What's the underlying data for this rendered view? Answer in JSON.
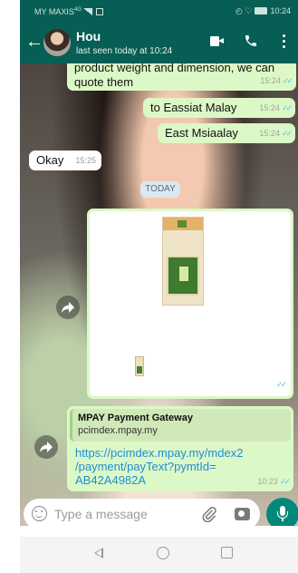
{
  "status_bar": {
    "carrier": "MY MAXIS",
    "network": "4G",
    "time": "10:24"
  },
  "header": {
    "back_icon": "arrow-left-icon",
    "contact_name": "Hou",
    "last_seen": "last seen today at 10:24",
    "video_icon": "video-camera-icon",
    "call_icon": "phone-icon",
    "menu_icon": "more-vert-icon",
    "bar_color": "#075e54"
  },
  "messages": [
    {
      "direction": "out",
      "text": "product weight and dimension, we can quote them",
      "time": "15:24",
      "read": true
    },
    {
      "direction": "out",
      "text": "to Eassiat Malay",
      "time": "15:24",
      "read": true
    },
    {
      "direction": "out",
      "text": "East Msiaalay",
      "time": "15:24",
      "read": true
    },
    {
      "direction": "in",
      "text": "Okay",
      "time": "15:25"
    }
  ],
  "date_divider": "TODAY",
  "image_message": {
    "direction": "out",
    "time": "10:23",
    "read": true
  },
  "link_message": {
    "direction": "out",
    "preview_title": "MPAY Payment Gateway",
    "preview_domain": "pcimdex.mpay.my",
    "url": "https://pcimdex.mpay.my/mdex2/payment/payText?pymtId=AB42A4982A",
    "time": "10:23",
    "read": true
  },
  "colors": {
    "outgoing_bubble": "#dcf8c6",
    "incoming_bubble": "#ffffff",
    "read_ticks": "#4fc3f7",
    "link": "#1d8ed6",
    "mic_button": "#00897b"
  },
  "composer": {
    "placeholder": "Type a message",
    "emoji_icon": "emoji-icon",
    "attach_icon": "paperclip-icon",
    "camera_icon": "camera-icon",
    "mic_icon": "microphone-icon"
  },
  "nav_bar": {
    "back_icon": "nav-back-icon",
    "home_icon": "nav-home-icon",
    "recents_icon": "nav-recents-icon"
  }
}
